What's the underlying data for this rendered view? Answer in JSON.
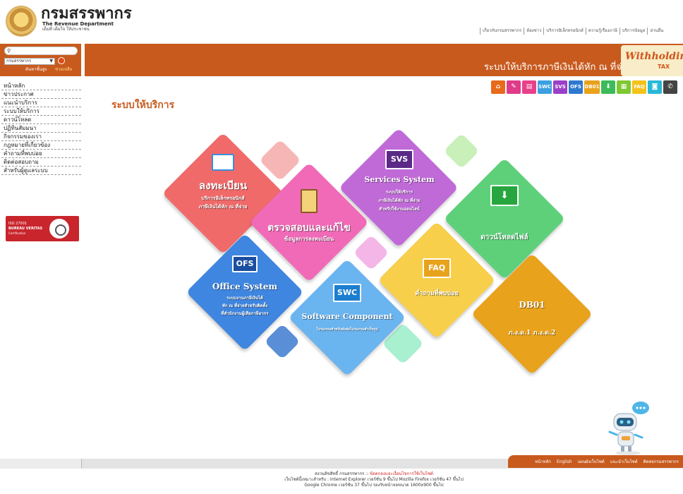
{
  "header": {
    "logo_title": "กรมสรรพากร",
    "logo_sub_en": "The Revenue Department",
    "logo_sub_th": "เต็มที่ เต็มใจ ให้ประชาชน",
    "top_links": [
      "เกี่ยวกับกรมสรรพากร",
      "ห้องข่าว",
      "บริการอิเล็กทรอนิกส์",
      "ความรู้เรื่องภาษี",
      "บริการข้อมูล",
      "อ่านอื่น"
    ]
  },
  "search": {
    "placeholder": "",
    "select_value": "กรมสรรพากร",
    "advanced_label": "ค้นหาขั้นสูง",
    "help_label": "ช่วยเหลือ"
  },
  "banner": {
    "title": "ระบบให้บริการภาษีเงินได้หัก ณ ที่จ่าย",
    "logo_text": "Withholding",
    "logo_tax": "TAX"
  },
  "sidebar": {
    "items": [
      "หน้าหลัก",
      "ข่าวประกาศ",
      "แนะนำบริการ",
      "ระบบให้บริการ",
      "ดาวน์โหลด",
      "ปฏิทินสัมมนา",
      "กิจกรรมของเรา",
      "กฎหมายที่เกี่ยวข้อง",
      "คำถามที่พบบ่อย",
      "ติดต่อสอบถาม",
      "สำหรับผู้ดูแลระบบ"
    ],
    "cert": {
      "line1": "ISO 27001",
      "line2": "BUREAU VERITAS",
      "line3": "Certification"
    }
  },
  "toolbar": {
    "icons": [
      {
        "name": "home-icon",
        "label": "⌂",
        "color": "#e86a1c"
      },
      {
        "name": "signup-icon",
        "label": "✎",
        "color": "#e03a8a"
      },
      {
        "name": "id-card-icon",
        "label": "▤",
        "color": "#e8408a"
      },
      {
        "name": "swc-icon",
        "label": "SWC",
        "color": "#3aa0e0"
      },
      {
        "name": "svs-icon",
        "label": "SVS",
        "color": "#9a40c8"
      },
      {
        "name": "ofs-icon",
        "label": "OFS",
        "color": "#2f78d0"
      },
      {
        "name": "db01-icon",
        "label": "DB01",
        "color": "#e8a21c"
      },
      {
        "name": "download-icon",
        "label": "⬇",
        "color": "#3dbb5a"
      },
      {
        "name": "document-icon",
        "label": "▦",
        "color": "#7fc832"
      },
      {
        "name": "faq-icon",
        "label": "FAQ",
        "color": "#f5c21c"
      },
      {
        "name": "chat-icon",
        "label": "◙",
        "color": "#28b8d8"
      },
      {
        "name": "phone-icon",
        "label": "✆",
        "color": "#444444"
      }
    ]
  },
  "page": {
    "title": "ระบบให้บริการ"
  },
  "tiles": {
    "register": {
      "title": "ลงทะเบียน",
      "desc1": "บริการอิเล็กทรอนิกส์",
      "desc2": "ภาษีเงินได้หัก ณ ที่จ่าย",
      "color": "#f06a6a"
    },
    "verify": {
      "title": "ตรวจสอบและแก้ไข",
      "desc1": "ข้อมูลการลงทะเบียน",
      "color": "#f06ab8"
    },
    "svs": {
      "badge": "SVS",
      "title": "Services System",
      "desc1": "ระบบให้บริการ",
      "desc2": "ภาษีเงินได้หัก ณ ที่จ่าย",
      "desc3": "สำหรับใช้งานออนไลน์",
      "color": "#c06ad8"
    },
    "download": {
      "title": "ดาวน์โหลดไฟล์",
      "color": "#5ed07a"
    },
    "ofs": {
      "badge": "OFS",
      "title": "Office System",
      "desc1": "ระบบงานภาษีเงินได้",
      "desc2": "หัก ณ ที่จ่ายสำหรับติดตั้ง",
      "desc3": "ที่สำนักงานผู้เสียภาษีอากร",
      "color": "#3f86e0"
    },
    "swc": {
      "badge": "SWC",
      "title": "Software Component",
      "desc1": "โปรแกรมสำหรับส่งต่อโปรแกรมสำเร็จรูป",
      "color": "#6ab4f0"
    },
    "faq": {
      "badge": "FAQ",
      "title": "คำถามที่พบบ่อย",
      "color": "#f7cf4a"
    },
    "db01": {
      "badge": "DB01",
      "title": "ภ.ง.ด.1 ภ.ง.ด.2",
      "color": "#e8a21c"
    }
  },
  "footer": {
    "links": [
      "หน้าหลัก",
      "English",
      "แผนผังเว็บไซต์",
      "แนะนำเว็บไซต์",
      "ติดต่อกรมสรรพากร"
    ],
    "copyright_prefix": "สงวนลิขสิทธิ์ กรมสรรพากร :: ",
    "copyright_link": "ข้อตกลงและเงื่อนไขการใช้เว็บไซต์",
    "browser_line1": "เว็บไซต์นี้เหมาะสำหรับ : Internet Explorer เวอร์ชั่น 9 ขึ้นไป Mozilla Firefox เวอร์ชั่น 47 ขึ้นไป",
    "browser_line2": "Google Chrome เวอร์ชั่น 37 ขึ้นไป รองรับหน้าจอขนาด 1600x900 ขึ้นไป"
  }
}
